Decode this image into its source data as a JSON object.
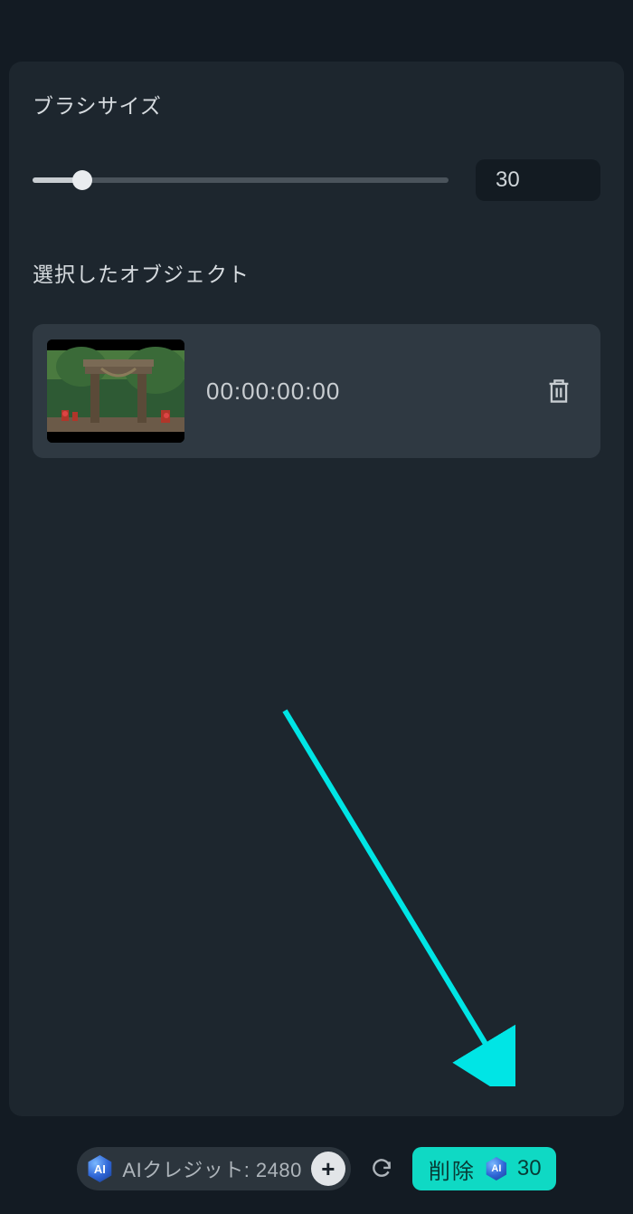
{
  "brush": {
    "title": "ブラシサイズ",
    "value": "30"
  },
  "objects": {
    "title": "選択したオブジェクト",
    "items": [
      {
        "timecode": "00:00:00:00"
      }
    ]
  },
  "footer": {
    "credits_label": "AIクレジット: 2480",
    "plus": "+",
    "delete_label": "削除",
    "delete_cost": "30",
    "ai_badge_text": "AI"
  }
}
